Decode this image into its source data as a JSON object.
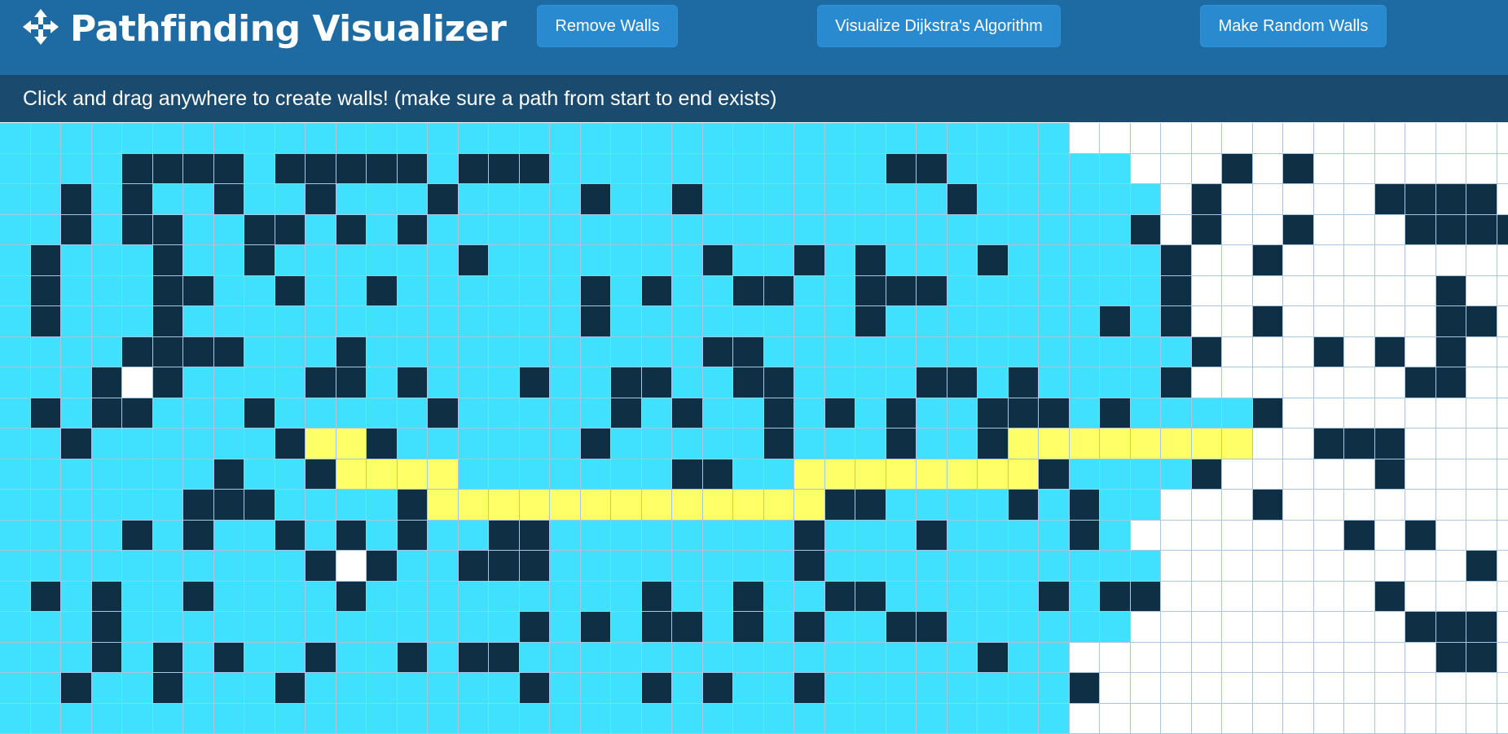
{
  "header": {
    "title": "Pathfinding Visualizer",
    "icon": "move-arrows-icon",
    "buttons": {
      "remove_walls": "Remove Walls",
      "visualize": "Visualize Dijkstra's Algorithm",
      "random_walls": "Make Random Walls"
    }
  },
  "instructions": "Click and drag anywhere to create walls! (make sure a path from start to end exists)",
  "colors": {
    "header_bg": "#1e6aa2",
    "button_bg": "#2a8ad0",
    "instructions_bg": "#1a4a6e",
    "wall": "#0e2f44",
    "visited": "#40e0ff",
    "path": "#ffff66",
    "empty": "#ffffff",
    "grid_line": "#a8c6e2"
  },
  "grid": {
    "cols": 50,
    "rows": 20,
    "legend": {
      ".": "empty",
      "v": "visited",
      "w": "wall",
      "p": "shortest-path"
    },
    "cells": [
      "vvvvvvvvvvvvvvvvvvvvvvvvvvvvvvvvvvv...............",
      "vvvvwwwwvwwwwwvwwwvvvvvvvvvvvwwvvvvvv...w.w.......",
      "vvwvwvvwvvwvvvwvvvvwvvwvvvvvvvvwvvvvvv.w.....wwww.",
      "vvwvwwvvwwvwvwvvvvvvvvvvvvvvvvvvvvvvvw.w..w...wwww",
      "vwvvvwvvwvvvvvvwvvvvvvvwvvwvwvvvwvvvvvw..w........",
      "vwvvvwwvvwvvwvvvvvvwvwvvwwvvwwwvvvvvvvw........w..",
      "vwvvvwvvvvvvvvvvvvvwvvvvvvvvwvvvvvvvwvw..w.....ww.",
      "vvvvwwwwvvvwvvvvvvvvvvvwwvvvvvvvvvvvvvvw...w.w.w..",
      "vvvwvwvvvvwwvwvvvwvvwwvvwwvvvvwwvwvvvvw.......ww..",
      "vwvwwvvvwvvvvvwvvvvvwvwvvwvwvwvvwwwvwvvvvw..........",
      "vvwvvvvvvwppwvvvvvvwvvvvvwvvvwvvwpppppppp..www....",
      "vvvvvvvwvvwppppvvvvvvvwwvvppppppppwvvvvw.....w.....",
      "vvvvvvwwwvvvvwpppppppppppppwwvvvvwvwvv...w.........",
      "vvvvwvwvvwvwvwvvwwvvvvvvvvwvvvwvvvvwv.......w.w....",
      "vvvvvvvvvvwvwvvwwwvvvvvvvvwvvvvvvvvvvv..........w..",
      "vwvwvvwvvvvwvvvvvvvvvwvvwvvwwvvvvvwvww.......w.....",
      "vvvwvvvvvvvvvvvvvwvwvwwvwvwvvwwvvvvvv.........www.",
      "vvvwvwvwvvwvvwvwwvvvvvvvvvvvvvvvwvv............ww.w",
      "vvwvvwvvvwvvvvvvvwvvvwvwvvwvvvvvvvvw..............",
      "vvvvvvvvvvvvvvvvvvvvvvvvvvvvvvvvvvv..............."
    ],
    "start": [
      8,
      4
    ],
    "end": [
      14,
      11
    ]
  }
}
